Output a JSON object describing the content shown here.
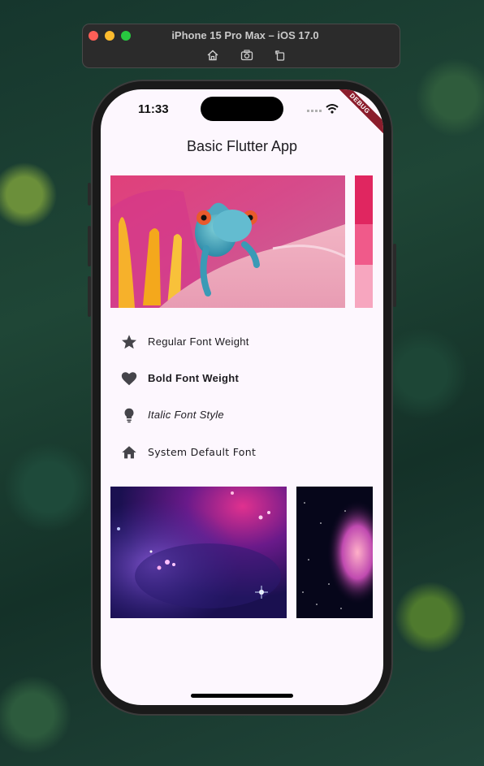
{
  "simulator": {
    "title": "iPhone 15 Pro Max – iOS 17.0",
    "tools": [
      "home-icon",
      "screenshot-icon",
      "rotate-icon"
    ]
  },
  "status_bar": {
    "time": "11:33",
    "debug_banner": "DEBUG"
  },
  "app": {
    "title": "Basic Flutter App",
    "list": [
      {
        "icon": "star-icon",
        "label": "Regular Font Weight",
        "style": "regular"
      },
      {
        "icon": "heart-icon",
        "label": "Bold Font Weight",
        "style": "bold"
      },
      {
        "icon": "lightbulb-icon",
        "label": "Italic Font Style",
        "style": "italic"
      },
      {
        "icon": "home-icon",
        "label": "System Default Font",
        "style": "default"
      }
    ]
  },
  "colors": {
    "screen_background": "#fdf7fe",
    "text": "#1d1b20",
    "icon": "#45444a",
    "debug_banner": "#8b1d2c"
  }
}
